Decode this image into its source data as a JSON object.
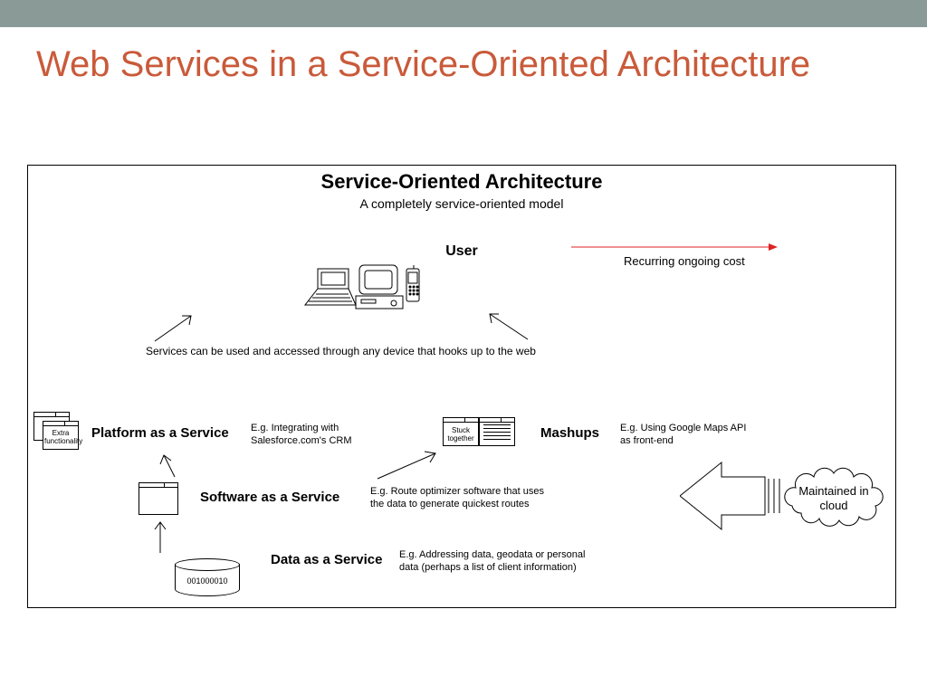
{
  "slide": {
    "title": "Web Services in a Service-Oriented Architecture"
  },
  "diagram": {
    "heading": "Service-Oriented Architecture",
    "subheading": "A completely service-oriented model",
    "user_label": "User",
    "devices_caption": "Services can be used and accessed through any device that hooks up to the web",
    "recurring_cost": "Recurring ongoing cost",
    "paas": {
      "title": "Platform as a Service",
      "example": "E.g. Integrating with Salesforce.com's CRM",
      "badge": "Extra functionality"
    },
    "mashups": {
      "title": "Mashups",
      "example": "E.g. Using Google Maps API as front-end",
      "badge": "Stuck together"
    },
    "saas": {
      "title": "Software as a Service",
      "example": "E.g. Route optimizer software that uses the data to generate quickest routes"
    },
    "daas": {
      "title": "Data as a Service",
      "example": "E.g. Addressing data, geodata or personal data (perhaps a list of client information)",
      "cylinder_text": "001000010"
    },
    "cloud_label": "Maintained in cloud"
  }
}
